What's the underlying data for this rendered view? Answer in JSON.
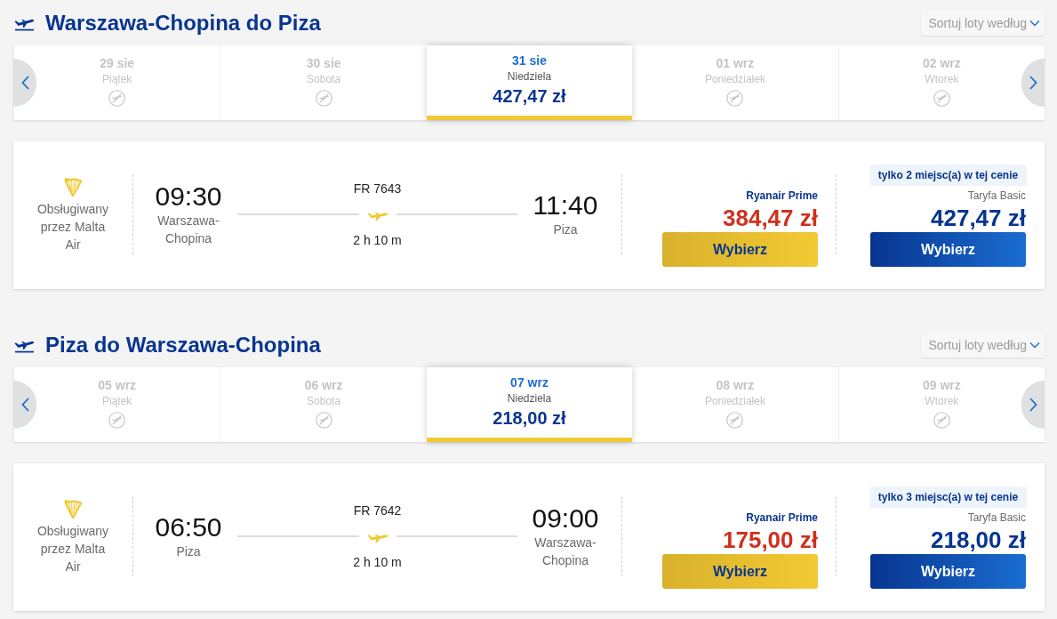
{
  "sections": [
    {
      "title": "Warszawa-Chopina do Piza",
      "sort": {
        "label": "Sortuj loty według"
      },
      "dates": [
        {
          "date": "29 sie",
          "day": "Piątek",
          "disabled": true,
          "selected": false
        },
        {
          "date": "30 sie",
          "day": "Sobota",
          "disabled": true,
          "selected": false
        },
        {
          "date": "31 sie",
          "day": "Niedziela",
          "price": "427,47 zł",
          "disabled": false,
          "selected": true
        },
        {
          "date": "01 wrz",
          "day": "Poniedziałek",
          "disabled": true,
          "selected": false
        },
        {
          "date": "02 wrz",
          "day": "Wtorek",
          "disabled": true,
          "selected": false
        }
      ],
      "flight": {
        "operator": "Obsługiwany przez Malta Air",
        "departure": {
          "time": "09:30",
          "city": "Warszawa-Chopina"
        },
        "flight_number": "FR 7643",
        "duration": "2 h 10 m",
        "arrival": {
          "time": "11:40",
          "city": "Piza"
        },
        "fares": [
          {
            "kind": "prime",
            "name": "Ryanair Prime",
            "price": "384,47 zł",
            "button": "Wybierz"
          },
          {
            "kind": "basic",
            "badge": "tylko 2 miejsc(a) w tej cenie",
            "name": "Taryfa Basic",
            "price": "427,47 zł",
            "button": "Wybierz"
          }
        ]
      }
    },
    {
      "title": "Piza do Warszawa-Chopina",
      "sort": {
        "label": "Sortuj loty według"
      },
      "dates": [
        {
          "date": "05 wrz",
          "day": "Piątek",
          "disabled": true,
          "selected": false
        },
        {
          "date": "06 wrz",
          "day": "Sobota",
          "disabled": true,
          "selected": false
        },
        {
          "date": "07 wrz",
          "day": "Niedziela",
          "price": "218,00 zł",
          "disabled": false,
          "selected": true
        },
        {
          "date": "08 wrz",
          "day": "Poniedziałek",
          "disabled": true,
          "selected": false
        },
        {
          "date": "09 wrz",
          "day": "Wtorek",
          "disabled": true,
          "selected": false
        }
      ],
      "flight": {
        "operator": "Obsługiwany przez Malta Air",
        "departure": {
          "time": "06:50",
          "city": "Piza"
        },
        "flight_number": "FR 7642",
        "duration": "2 h 10 m",
        "arrival": {
          "time": "09:00",
          "city": "Warszawa-Chopina"
        },
        "fares": [
          {
            "kind": "prime",
            "name": "Ryanair Prime",
            "price": "175,00 zł",
            "button": "Wybierz"
          },
          {
            "kind": "basic",
            "badge": "tylko 3 miejsc(a) w tej cenie",
            "name": "Taryfa Basic",
            "price": "218,00 zł",
            "button": "Wybierz"
          }
        ]
      }
    }
  ]
}
